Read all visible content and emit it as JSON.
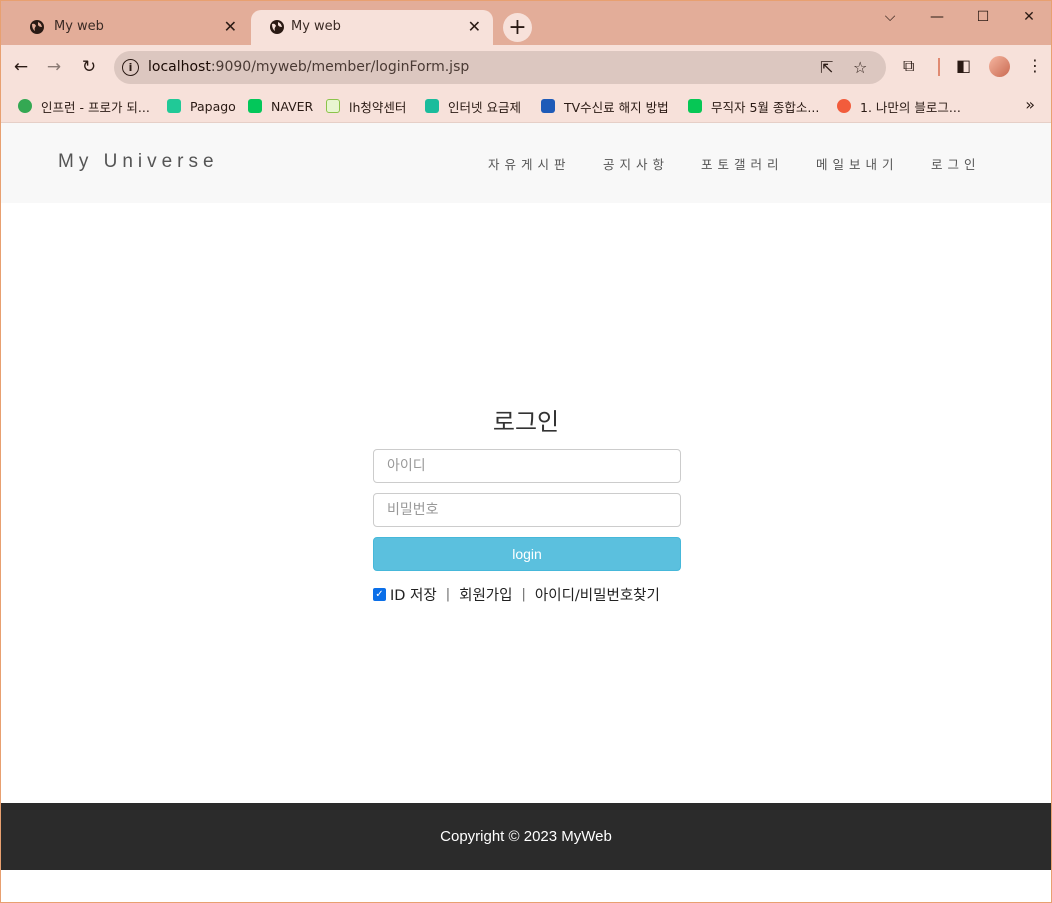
{
  "browser": {
    "tabs": [
      {
        "title": "My web",
        "close": "✕"
      },
      {
        "title": "My web",
        "close": "✕"
      }
    ],
    "new_tab": "+",
    "window_controls": {
      "dropdown": "⌵",
      "minimize": "—",
      "maximize": "☐",
      "close": "✕"
    },
    "nav": {
      "back": "←",
      "forward": "→",
      "reload": "↻"
    },
    "url_host": "localhost",
    "url_rest": ":9090/myweb/member/loginForm.jsp",
    "bookmarks": [
      {
        "label": "인프런 - 프로가 되...",
        "color": "#34a853"
      },
      {
        "label": "Papago",
        "color": "#20c997"
      },
      {
        "label": "NAVER",
        "color": "#03c75a"
      },
      {
        "label": "lh청약센터",
        "color": "#8bc34a"
      },
      {
        "label": "인터넷 요금제",
        "color": "#1abc9c"
      },
      {
        "label": "TV수신료 해지 방법",
        "color": "#1e5bb8"
      },
      {
        "label": "무직자 5월 종합소...",
        "color": "#06c755"
      },
      {
        "label": "1. 나만의 블로그...",
        "color": "#f25c3c"
      }
    ],
    "bookmarks_more": "»"
  },
  "site": {
    "brand": "My Universe",
    "nav": [
      "자유게시판",
      "공지사항",
      "포토갤러리",
      "메일보내기",
      "로그인"
    ],
    "login": {
      "title": "로그인",
      "id_placeholder": "아이디",
      "pw_placeholder": "비밀번호",
      "button": "login",
      "remember_label": "ID 저장",
      "remember_checked": true,
      "separator": "|",
      "signup": "회원가입",
      "find": "아이디/비밀번호찾기"
    },
    "footer": "Copyright © 2023 MyWeb"
  }
}
